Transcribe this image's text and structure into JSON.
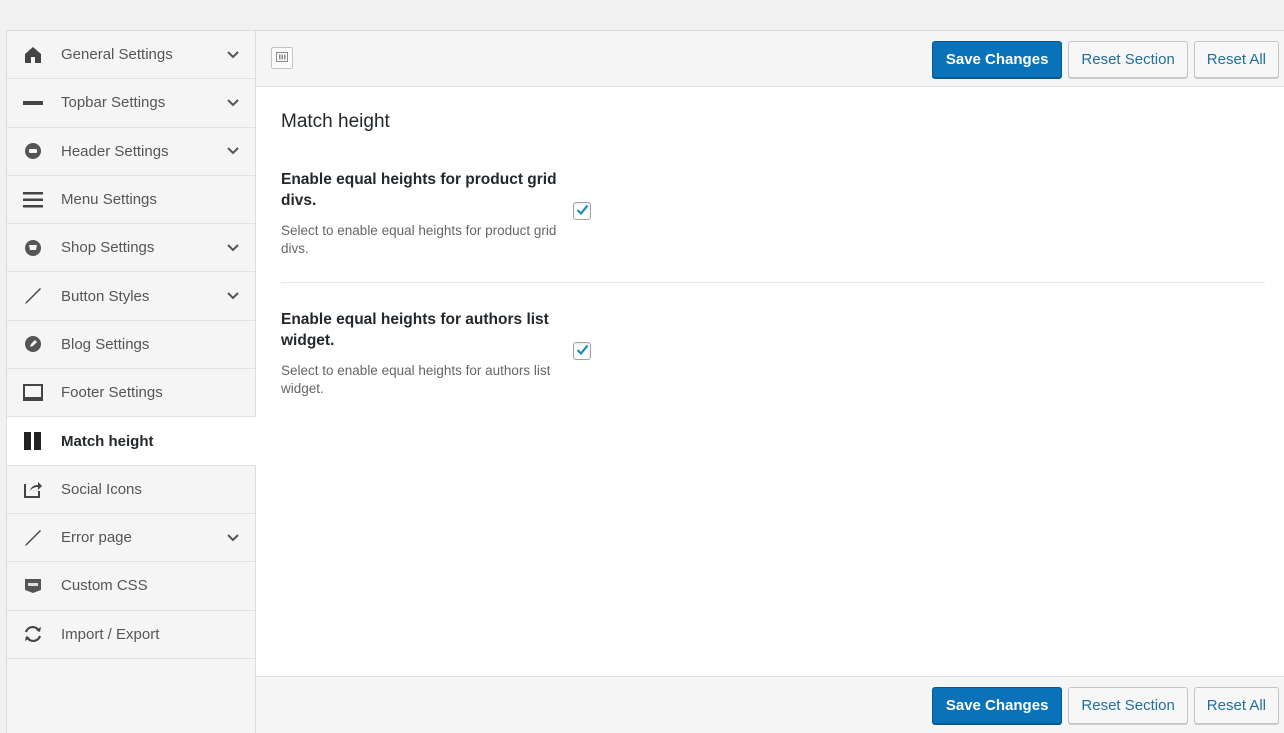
{
  "sidebar": {
    "items": [
      {
        "label": "General Settings",
        "icon": "home-icon",
        "has_submenu": true
      },
      {
        "label": "Topbar Settings",
        "icon": "minus-icon",
        "has_submenu": true
      },
      {
        "label": "Header Settings",
        "icon": "circle-icon",
        "has_submenu": true
      },
      {
        "label": "Menu Settings",
        "icon": "hamburger-menu-icon",
        "has_submenu": false
      },
      {
        "label": "Shop Settings",
        "icon": "shopping-icon",
        "has_submenu": true
      },
      {
        "label": "Button Styles",
        "icon": "brush-icon",
        "has_submenu": true
      },
      {
        "label": "Blog Settings",
        "icon": "pencil-circle-icon",
        "has_submenu": false
      },
      {
        "label": "Footer Settings",
        "icon": "monitor-icon",
        "has_submenu": false
      },
      {
        "label": "Match height",
        "icon": "columns-icon",
        "has_submenu": false,
        "active": true
      },
      {
        "label": "Social Icons",
        "icon": "share-icon",
        "has_submenu": false
      },
      {
        "label": "Error page",
        "icon": "brush-icon",
        "has_submenu": true
      },
      {
        "label": "Custom CSS",
        "icon": "css-icon",
        "has_submenu": false
      },
      {
        "label": "Import / Export",
        "icon": "refresh-icon",
        "has_submenu": false
      }
    ]
  },
  "toolbar": {
    "save_label": "Save Changes",
    "reset_section_label": "Reset Section",
    "reset_all_label": "Reset All"
  },
  "main": {
    "section_title": "Match height",
    "fields": [
      {
        "title": "Enable equal heights for product grid divs.",
        "description": "Select to enable equal heights for product grid divs.",
        "checked": true
      },
      {
        "title": "Enable equal heights for authors list widget.",
        "description": "Select to enable equal heights for authors list widget.",
        "checked": true
      }
    ]
  },
  "colors": {
    "primary_button": "#0a72b8",
    "link": "#1f6fa0",
    "checkmark": "#1e8cbe"
  }
}
